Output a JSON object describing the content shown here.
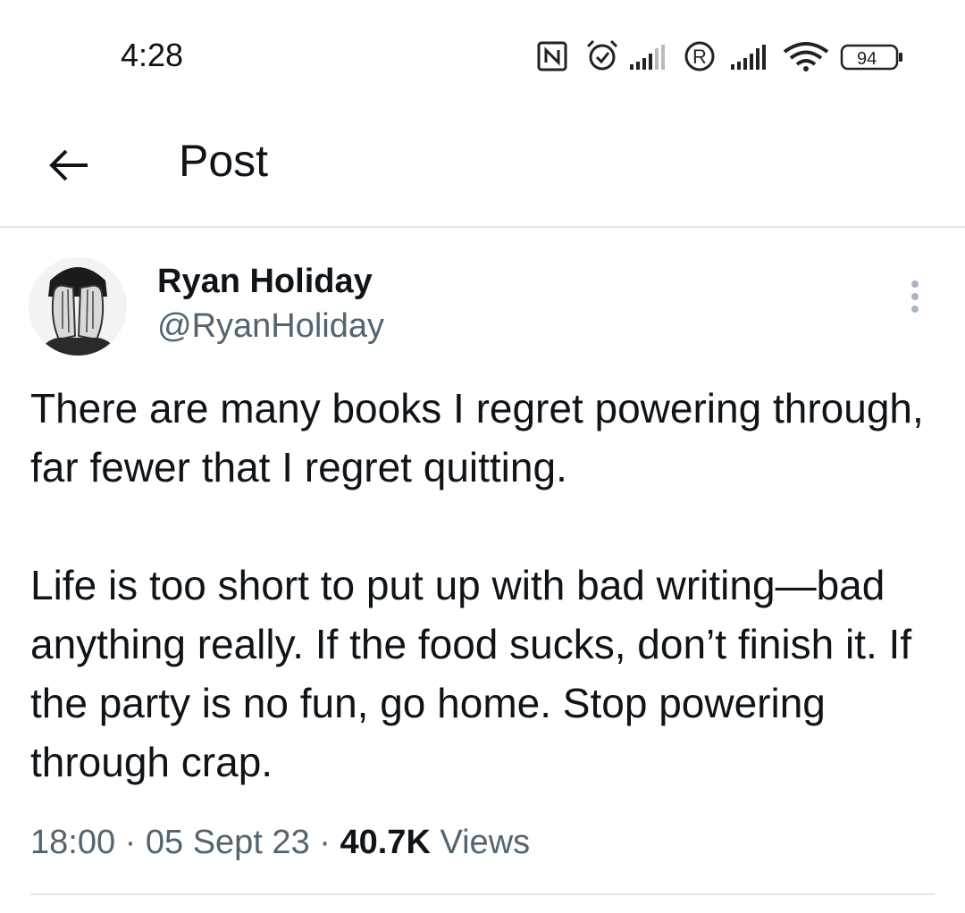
{
  "status_bar": {
    "time": "4:28",
    "battery": "94",
    "icons": [
      "nfc-icon",
      "alarm-icon",
      "signal-bars-icon",
      "roaming-icon",
      "signal-bars-icon",
      "wifi-icon",
      "battery-icon"
    ]
  },
  "header": {
    "title": "Post",
    "back_icon": "arrow-left-icon"
  },
  "post": {
    "author_name": "Ryan Holiday",
    "author_handle": "@RyanHoliday",
    "paragraphs": [
      "There are many books I regret powering through, far fewer that I regret quitting.",
      "Life is too short to put up with bad writing—bad anything really. If the food sucks, don’t finish it. If the party is no fun, go home. Stop powering through crap."
    ],
    "time": "18:00",
    "separator": "·",
    "date": "05 Sept 23",
    "views_count": "40.7K",
    "views_label": "Views"
  },
  "colors": {
    "text_primary": "#0f1419",
    "text_secondary": "#536471",
    "divider": "#e3e6e8",
    "more_dots": "#a0b0c0"
  }
}
